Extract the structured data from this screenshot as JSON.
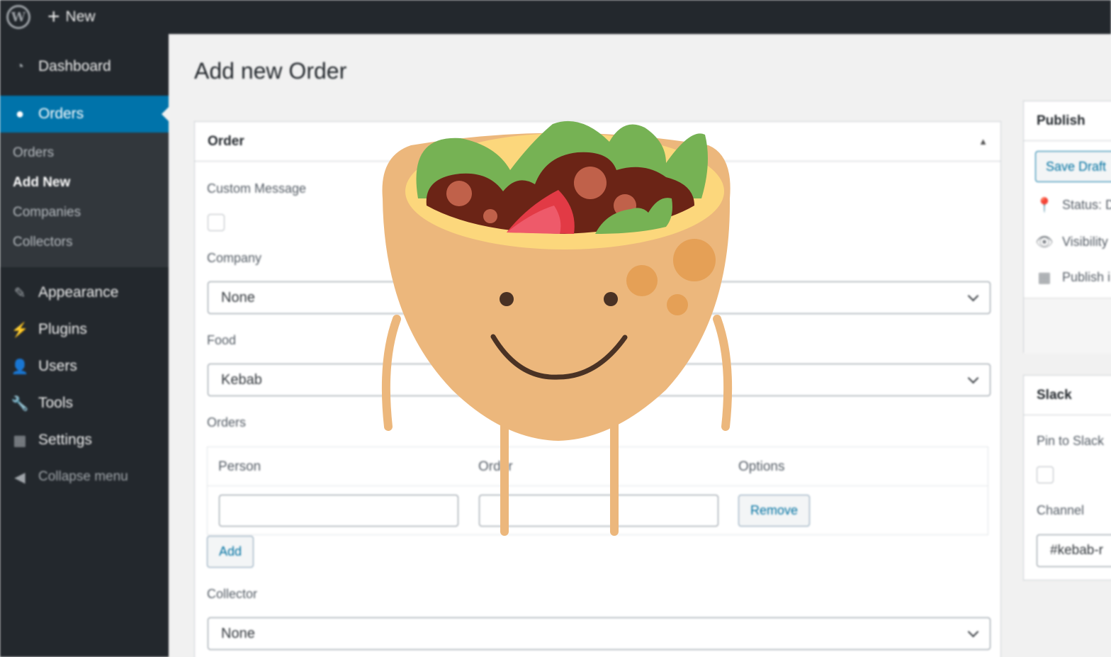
{
  "admin_bar": {
    "logo_letter": "W",
    "new_label": "New"
  },
  "sidebar": {
    "dashboard": "Dashboard",
    "orders": "Orders",
    "submenu": [
      "Orders",
      "Add New",
      "Companies",
      "Collectors"
    ],
    "appearance": "Appearance",
    "plugins": "Plugins",
    "users": "Users",
    "tools": "Tools",
    "settings": "Settings",
    "collapse": "Collapse menu"
  },
  "page": {
    "title": "Add new Order"
  },
  "order_box": {
    "title": "Order",
    "custom_message_label": "Custom Message",
    "company_label": "Company",
    "company_value": "None",
    "food_label": "Food",
    "food_value": "Kebab",
    "orders_label": "Orders",
    "table_headers": [
      "Person",
      "Order",
      "Options"
    ],
    "remove_label": "Remove",
    "add_label": "Add",
    "collector_label": "Collector",
    "collector_value": "None"
  },
  "publish_box": {
    "title": "Publish",
    "save_draft": "Save Draft",
    "status": "Status: D",
    "visibility": "Visibility",
    "publish": "Publish i"
  },
  "slack_box": {
    "title": "Slack",
    "pin_label": "Pin to Slack",
    "channel_label": "Channel",
    "channel_value": "#kebab-r"
  },
  "colors": {
    "admin_dark": "#23282d",
    "active_blue": "#0073aa",
    "mascot_body": "#ecb77c",
    "lettuce": "#76b254",
    "meat": "#6b2416"
  }
}
